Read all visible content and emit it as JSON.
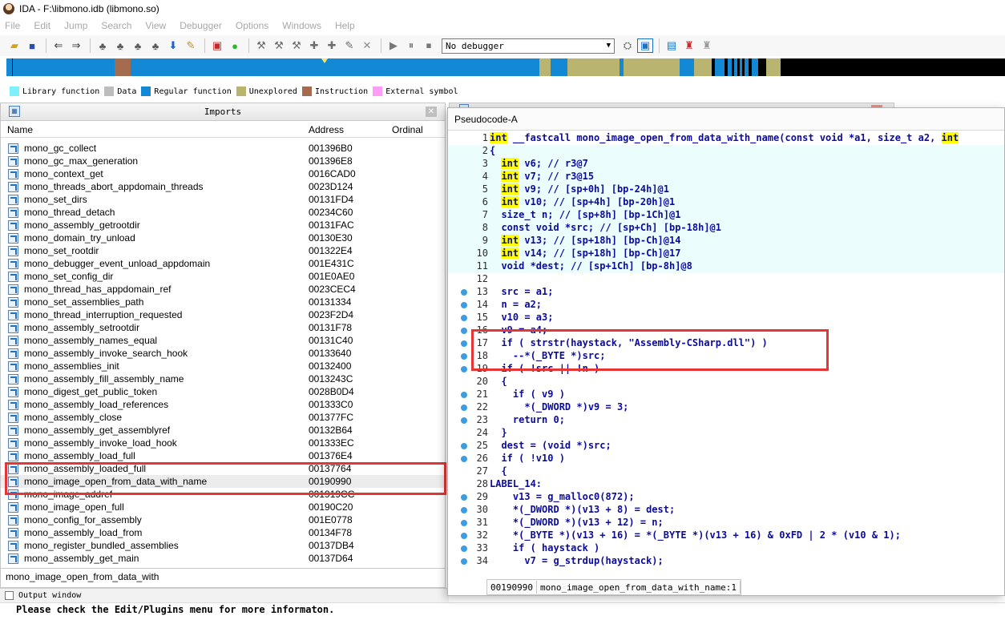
{
  "titlebar": {
    "title": "IDA - F:\\libmono.idb (libmono.so)"
  },
  "menubar": {
    "items": [
      "File",
      "Edit",
      "Jump",
      "Search",
      "View",
      "Debugger",
      "Options",
      "Windows",
      "Help"
    ]
  },
  "toolbar": {
    "debugger_value": "No debugger"
  },
  "colors": {
    "library_function": "#7cf0ff",
    "data": "#bdbdbd",
    "regular_function": "#1389d6",
    "unexplored": "#b9b46f",
    "instruction": "#a46b4e",
    "external_symbol": "#ff9cf5",
    "highlight_box": "#e53535"
  },
  "legend": {
    "items": [
      {
        "label": "Library function"
      },
      {
        "label": "Data"
      },
      {
        "label": "Regular function"
      },
      {
        "label": "Unexplored"
      },
      {
        "label": "Instruction"
      },
      {
        "label": "External symbol"
      }
    ]
  },
  "imports": {
    "title": "Imports",
    "columns": {
      "name": "Name",
      "address": "Address",
      "ordinal": "Ordinal"
    },
    "rows": [
      {
        "name": "mono_gc_collect",
        "address": "001396B0"
      },
      {
        "name": "mono_gc_max_generation",
        "address": "001396E8"
      },
      {
        "name": "mono_context_get",
        "address": "0016CAD0"
      },
      {
        "name": "mono_threads_abort_appdomain_threads",
        "address": "0023D124"
      },
      {
        "name": "mono_set_dirs",
        "address": "00131FD4"
      },
      {
        "name": "mono_thread_detach",
        "address": "00234C60"
      },
      {
        "name": "mono_assembly_getrootdir",
        "address": "00131FAC"
      },
      {
        "name": "mono_domain_try_unload",
        "address": "00130E30"
      },
      {
        "name": "mono_set_rootdir",
        "address": "001322E4"
      },
      {
        "name": "mono_debugger_event_unload_appdomain",
        "address": "001E431C"
      },
      {
        "name": "mono_set_config_dir",
        "address": "001E0AE0"
      },
      {
        "name": "mono_thread_has_appdomain_ref",
        "address": "0023CEC4"
      },
      {
        "name": "mono_set_assemblies_path",
        "address": "00131334"
      },
      {
        "name": "mono_thread_interruption_requested",
        "address": "0023F2D4"
      },
      {
        "name": "mono_assembly_setrootdir",
        "address": "00131F78"
      },
      {
        "name": "mono_assembly_names_equal",
        "address": "00131C40"
      },
      {
        "name": "mono_assembly_invoke_search_hook",
        "address": "00133640"
      },
      {
        "name": "mono_assemblies_init",
        "address": "00132400"
      },
      {
        "name": "mono_assembly_fill_assembly_name",
        "address": "0013243C"
      },
      {
        "name": "mono_digest_get_public_token",
        "address": "0028B0D4"
      },
      {
        "name": "mono_assembly_load_references",
        "address": "001333C0"
      },
      {
        "name": "mono_assembly_close",
        "address": "001377FC"
      },
      {
        "name": "mono_assembly_get_assemblyref",
        "address": "00132B64"
      },
      {
        "name": "mono_assembly_invoke_load_hook",
        "address": "001333EC"
      },
      {
        "name": "mono_assembly_load_full",
        "address": "001376E4"
      },
      {
        "name": "mono_assembly_loaded_full",
        "address": "00137764"
      },
      {
        "name": "mono_image_open_from_data_with_name",
        "address": "00190990"
      },
      {
        "name": "mono_image_addref",
        "address": "001919CC"
      },
      {
        "name": "mono_image_open_full",
        "address": "00190C20"
      },
      {
        "name": "mono_config_for_assembly",
        "address": "001E0778"
      },
      {
        "name": "mono_assembly_load_from",
        "address": "00134F78"
      },
      {
        "name": "mono_register_bundled_assemblies",
        "address": "00137DB4"
      },
      {
        "name": "mono_assembly_get_main",
        "address": "00137D64"
      }
    ],
    "status_text": "mono_image_open_from_data_with"
  },
  "output": {
    "title": "Output window",
    "text": "Please check the Edit/Plugins menu for more informaton."
  },
  "pseudocode": {
    "title": "Pseudocode-A",
    "lines": [
      {
        "n": "1",
        "pre": "",
        "kw": "int",
        "text": " __fastcall mono_image_open_from_data_with_name(const void *a1, size_t a2, ",
        "kw2": "int",
        "hl": false,
        "dot": false
      },
      {
        "n": "2",
        "pre": "",
        "kw": "",
        "text": "{",
        "kw2": "",
        "hl": true,
        "dot": false
      },
      {
        "n": "3",
        "pre": "  ",
        "kw": "int",
        "text": " v6; // r3@7",
        "kw2": "",
        "hl": true,
        "dot": false
      },
      {
        "n": "4",
        "pre": "  ",
        "kw": "int",
        "text": " v7; // r3@15",
        "kw2": "",
        "hl": true,
        "dot": false
      },
      {
        "n": "5",
        "pre": "  ",
        "kw": "int",
        "text": " v9; // [sp+0h] [bp-24h]@1",
        "kw2": "",
        "hl": true,
        "dot": false
      },
      {
        "n": "6",
        "pre": "  ",
        "kw": "int",
        "text": " v10; // [sp+4h] [bp-20h]@1",
        "kw2": "",
        "hl": true,
        "dot": false
      },
      {
        "n": "7",
        "pre": "  ",
        "kw": "",
        "text": "size_t n; // [sp+8h] [bp-1Ch]@1",
        "kw2": "",
        "hl": true,
        "dot": false
      },
      {
        "n": "8",
        "pre": "  ",
        "kw": "",
        "text": "const void *src; // [sp+Ch] [bp-18h]@1",
        "kw2": "",
        "hl": true,
        "dot": false
      },
      {
        "n": "9",
        "pre": "  ",
        "kw": "int",
        "text": " v13; // [sp+18h] [bp-Ch]@14",
        "kw2": "",
        "hl": true,
        "dot": false
      },
      {
        "n": "10",
        "pre": "  ",
        "kw": "int",
        "text": " v14; // [sp+18h] [bp-Ch]@17",
        "kw2": "",
        "hl": true,
        "dot": false
      },
      {
        "n": "11",
        "pre": "  ",
        "kw": "",
        "text": "void *dest; // [sp+1Ch] [bp-8h]@8",
        "kw2": "",
        "hl": true,
        "dot": false
      },
      {
        "n": "12",
        "pre": "",
        "kw": "",
        "text": "",
        "kw2": "",
        "hl": false,
        "dot": false
      },
      {
        "n": "13",
        "pre": "  ",
        "kw": "",
        "text": "src = a1;",
        "kw2": "",
        "hl": false,
        "dot": true
      },
      {
        "n": "14",
        "pre": "  ",
        "kw": "",
        "text": "n = a2;",
        "kw2": "",
        "hl": false,
        "dot": true
      },
      {
        "n": "15",
        "pre": "  ",
        "kw": "",
        "text": "v10 = a3;",
        "kw2": "",
        "hl": false,
        "dot": true
      },
      {
        "n": "16",
        "pre": "  ",
        "kw": "",
        "text": "v9 = a4;",
        "kw2": "",
        "hl": false,
        "dot": true
      },
      {
        "n": "17",
        "pre": "  ",
        "kw": "",
        "text": "if ( strstr(haystack, \"Assembly-CSharp.dll\") )",
        "kw2": "",
        "hl": false,
        "dot": true
      },
      {
        "n": "18",
        "pre": "    ",
        "kw": "",
        "text": "--*(_BYTE *)src;",
        "kw2": "",
        "hl": false,
        "dot": true
      },
      {
        "n": "19",
        "pre": "  ",
        "kw": "",
        "text": "if ( !src || !n )",
        "kw2": "",
        "hl": false,
        "dot": true
      },
      {
        "n": "20",
        "pre": "  ",
        "kw": "",
        "text": "{",
        "kw2": "",
        "hl": false,
        "dot": false
      },
      {
        "n": "21",
        "pre": "    ",
        "kw": "",
        "text": "if ( v9 )",
        "kw2": "",
        "hl": false,
        "dot": true
      },
      {
        "n": "22",
        "pre": "      ",
        "kw": "",
        "text": "*(_DWORD *)v9 = 3;",
        "kw2": "",
        "hl": false,
        "dot": true
      },
      {
        "n": "23",
        "pre": "    ",
        "kw": "",
        "text": "return 0;",
        "kw2": "",
        "hl": false,
        "dot": true
      },
      {
        "n": "24",
        "pre": "  ",
        "kw": "",
        "text": "}",
        "kw2": "",
        "hl": false,
        "dot": false
      },
      {
        "n": "25",
        "pre": "  ",
        "kw": "",
        "text": "dest = (void *)src;",
        "kw2": "",
        "hl": false,
        "dot": true
      },
      {
        "n": "26",
        "pre": "  ",
        "kw": "",
        "text": "if ( !v10 )",
        "kw2": "",
        "hl": false,
        "dot": true
      },
      {
        "n": "27",
        "pre": "  ",
        "kw": "",
        "text": "{",
        "kw2": "",
        "hl": false,
        "dot": false
      },
      {
        "n": "28",
        "pre": "",
        "kw": "",
        "text": "LABEL_14:",
        "kw2": "",
        "hl": false,
        "dot": false
      },
      {
        "n": "29",
        "pre": "    ",
        "kw": "",
        "text": "v13 = g_malloc0(872);",
        "kw2": "",
        "hl": false,
        "dot": true
      },
      {
        "n": "30",
        "pre": "    ",
        "kw": "",
        "text": "*(_DWORD *)(v13 + 8) = dest;",
        "kw2": "",
        "hl": false,
        "dot": true
      },
      {
        "n": "31",
        "pre": "    ",
        "kw": "",
        "text": "*(_DWORD *)(v13 + 12) = n;",
        "kw2": "",
        "hl": false,
        "dot": true
      },
      {
        "n": "32",
        "pre": "    ",
        "kw": "",
        "text": "*(_BYTE *)(v13 + 16) = *(_BYTE *)(v13 + 16) & 0xFD | 2 * (v10 & 1);",
        "kw2": "",
        "hl": false,
        "dot": true
      },
      {
        "n": "33",
        "pre": "    ",
        "kw": "",
        "text": "if ( haystack )",
        "kw2": "",
        "hl": false,
        "dot": true
      },
      {
        "n": "34",
        "pre": "      ",
        "kw": "",
        "text": "v7 = g_strdup(haystack);",
        "kw2": "",
        "hl": false,
        "dot": true
      }
    ],
    "status": {
      "address": "00190990",
      "location": "mono_image_open_from_data_with_name:1"
    }
  }
}
